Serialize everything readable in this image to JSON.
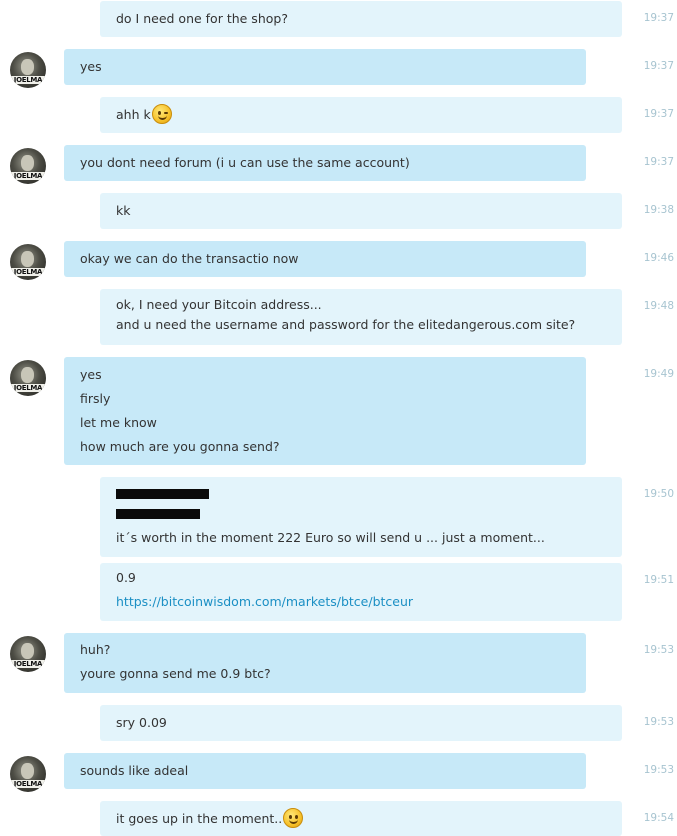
{
  "avatar_text": "JOELMA",
  "messages": [
    {
      "dir": "out",
      "lines": [
        "do I need one for the shop?"
      ],
      "time": "19:37"
    },
    {
      "dir": "in",
      "lines": [
        "yes"
      ],
      "time": "19:37"
    },
    {
      "dir": "out",
      "lines": [
        "ahh k"
      ],
      "emoji": "wink-smiley-icon",
      "time": "19:37"
    },
    {
      "dir": "in",
      "lines": [
        "you dont need forum (i u can use the same account)"
      ],
      "time": "19:37"
    },
    {
      "dir": "out",
      "lines": [
        "kk"
      ],
      "time": "19:38"
    },
    {
      "dir": "in",
      "lines": [
        "okay we can do the transactio now"
      ],
      "time": "19:46"
    },
    {
      "dir": "out",
      "lines": [
        "ok, I need your Bitcoin address...",
        "and u need the username and password for the elitedangerous.com site?"
      ],
      "time": "19:48"
    },
    {
      "dir": "in",
      "lines": [
        "yes",
        "firsly",
        "let me know",
        "how much are you gonna send?"
      ],
      "time": "19:49"
    },
    {
      "dir": "out",
      "lines": [
        "it´s worth in the moment 222 Euro so will send u ... just a moment..."
      ],
      "redacted": true,
      "time": "19:50"
    },
    {
      "dir": "out",
      "lines": [
        "0.9",
        "https://bitcoinwisdom.com/markets/btce/btceur"
      ],
      "time": "19:51"
    },
    {
      "dir": "in",
      "lines": [
        "huh?",
        "youre gonna send me 0.9 btc?"
      ],
      "time": "19:53"
    },
    {
      "dir": "out",
      "lines": [
        "sry 0.09"
      ],
      "time": "19:53"
    },
    {
      "dir": "in",
      "lines": [
        "sounds like adeal"
      ],
      "time": "19:53"
    },
    {
      "dir": "out",
      "lines": [
        "it goes up in the moment.."
      ],
      "emoji": "smiley-icon",
      "time": "19:54"
    }
  ]
}
